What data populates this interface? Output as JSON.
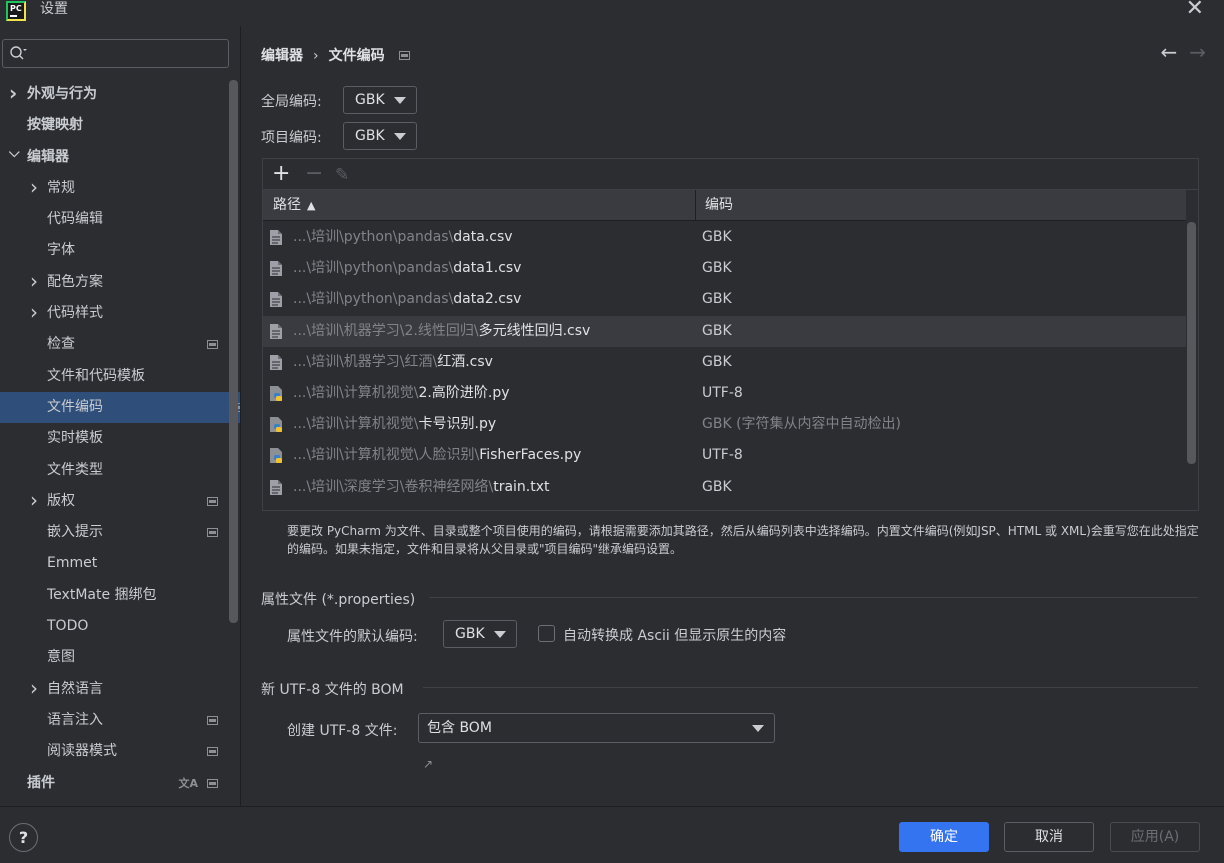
{
  "window": {
    "title": "设置",
    "logo_text": "PC"
  },
  "sidebar": {
    "search_placeholder": "",
    "items": [
      {
        "label": "外观与行为",
        "level": 0,
        "chevron": "right",
        "bold": true
      },
      {
        "label": "按键映射",
        "level": 0,
        "chevron": "",
        "bold": true
      },
      {
        "label": "编辑器",
        "level": 0,
        "chevron": "down",
        "bold": true
      },
      {
        "label": "常规",
        "level": 1,
        "chevron": "right"
      },
      {
        "label": "代码编辑",
        "level": 1,
        "chevron": ""
      },
      {
        "label": "字体",
        "level": 1,
        "chevron": ""
      },
      {
        "label": "配色方案",
        "level": 1,
        "chevron": "right"
      },
      {
        "label": "代码样式",
        "level": 1,
        "chevron": "right"
      },
      {
        "label": "检查",
        "level": 1,
        "chevron": "",
        "page_icon": true
      },
      {
        "label": "文件和代码模板",
        "level": 1,
        "chevron": ""
      },
      {
        "label": "文件编码",
        "level": 1,
        "chevron": "",
        "page_icon": true,
        "selected": true
      },
      {
        "label": "实时模板",
        "level": 1,
        "chevron": ""
      },
      {
        "label": "文件类型",
        "level": 1,
        "chevron": ""
      },
      {
        "label": "版权",
        "level": 1,
        "chevron": "right",
        "page_icon": true
      },
      {
        "label": "嵌入提示",
        "level": 1,
        "chevron": "",
        "page_icon": true
      },
      {
        "label": "Emmet",
        "level": 1,
        "chevron": ""
      },
      {
        "label": "TextMate 捆绑包",
        "level": 1,
        "chevron": ""
      },
      {
        "label": "TODO",
        "level": 1,
        "chevron": ""
      },
      {
        "label": "意图",
        "level": 1,
        "chevron": ""
      },
      {
        "label": "自然语言",
        "level": 1,
        "chevron": "right"
      },
      {
        "label": "语言注入",
        "level": 1,
        "chevron": "",
        "page_icon": true
      },
      {
        "label": "阅读器模式",
        "level": 1,
        "chevron": "",
        "page_icon": true
      },
      {
        "label": "插件",
        "level": 0,
        "chevron": "",
        "bold": true,
        "page_icon": true,
        "translate_icon": true
      }
    ]
  },
  "main": {
    "breadcrumb": {
      "parent": "编辑器",
      "separator": "›",
      "current": "文件编码"
    },
    "nav": {
      "back": "←",
      "forward": "→"
    },
    "global_encoding": {
      "label": "全局编码:",
      "value": "GBK"
    },
    "project_encoding": {
      "label": "项目编码:",
      "value": "GBK"
    },
    "table": {
      "toolbar": {
        "add": "+",
        "remove": "−",
        "edit": "✎"
      },
      "columns": {
        "path": "路径",
        "sort": "▲",
        "encoding": "编码"
      },
      "rows": [
        {
          "dir": "...\\培训\\python\\pandas\\",
          "file": "data.csv",
          "encoding": "GBK",
          "icon": "text-file-icon"
        },
        {
          "dir": "...\\培训\\python\\pandas\\",
          "file": "data1.csv",
          "encoding": "GBK",
          "icon": "text-file-icon"
        },
        {
          "dir": "...\\培训\\python\\pandas\\",
          "file": "data2.csv",
          "encoding": "GBK",
          "icon": "text-file-icon"
        },
        {
          "dir": "...\\培训\\机器学习\\2.线性回归\\",
          "file": "多元线性回归.csv",
          "encoding": "GBK",
          "icon": "text-file-icon",
          "highlight": true
        },
        {
          "dir": "...\\培训\\机器学习\\红酒\\",
          "file": "红酒.csv",
          "encoding": "GBK",
          "icon": "text-file-icon"
        },
        {
          "dir": "...\\培训\\计算机视觉\\",
          "file": "2.高阶进阶.py",
          "encoding": "UTF-8",
          "icon": "python-file-icon"
        },
        {
          "dir": "...\\培训\\计算机视觉\\",
          "file": "卡号识别.py",
          "encoding": "GBK (字符集从内容中自动检出)",
          "icon": "python-file-icon",
          "enc_dim": true
        },
        {
          "dir": "...\\培训\\计算机视觉\\人脸识别\\",
          "file": "FisherFaces.py",
          "encoding": "UTF-8",
          "icon": "python-file-icon"
        },
        {
          "dir": "...\\培训\\深度学习\\卷积神经网络\\",
          "file": "train.txt",
          "encoding": "GBK",
          "icon": "text-file-icon"
        }
      ]
    },
    "help_text": "要更改 PyCharm 为文件、目录或整个项目使用的编码，请根据需要添加其路径，然后从编码列表中选择编码。内置文件编码(例如JSP、HTML 或 XML)会重写您在此处指定的编码。如果未指定，文件和目录将从父目录或\"项目编码\"继承编码设置。",
    "properties": {
      "title": "属性文件 (*.properties)",
      "default_label": "属性文件的默认编码:",
      "default_value": "GBK",
      "checkbox_label": "自动转换成 Ascii 但显示原生的内容",
      "checked": false
    },
    "bom": {
      "title": "新 UTF-8 文件的 BOM",
      "label": "创建 UTF-8 文件:",
      "value": "包含 BOM",
      "link_arrow": "↗"
    }
  },
  "footer": {
    "help": "?",
    "ok": "确定",
    "cancel": "取消",
    "apply": "应用(A)"
  },
  "colors": {
    "background": "#2b2d30",
    "selected": "#2f4f7a",
    "accent": "#3574f0"
  }
}
